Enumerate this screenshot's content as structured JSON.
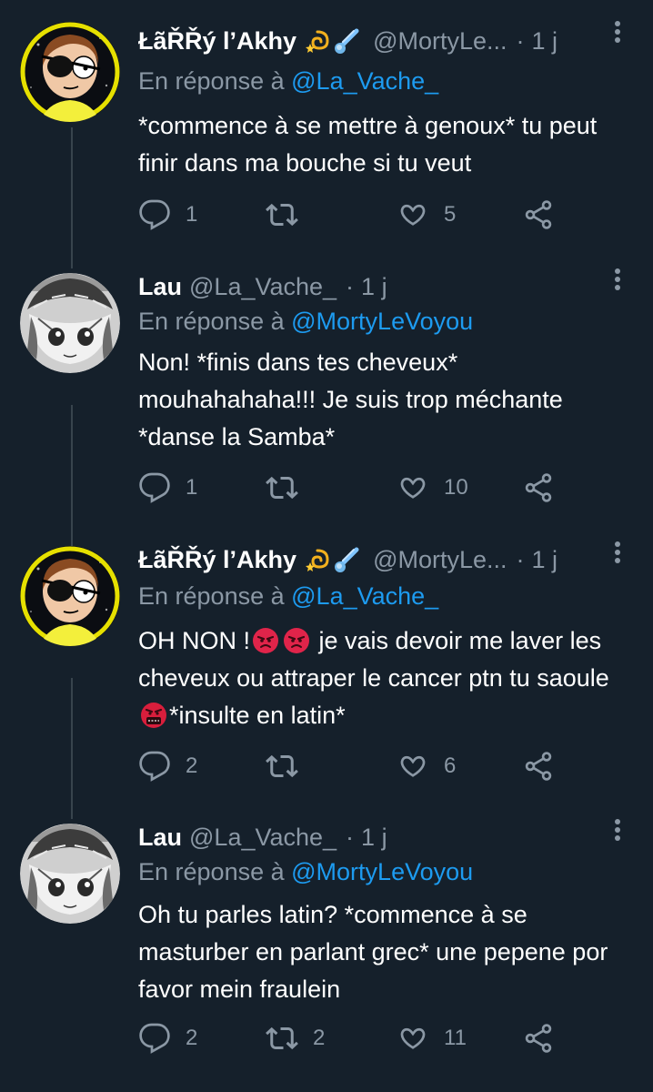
{
  "tweets": [
    {
      "name": "ŁãŘŘý l’Akhy",
      "handle": "@MortyLe...",
      "dot": "·",
      "time": "1 j",
      "reply_prefix": "En réponse à",
      "reply_mention": "@La_Vache_",
      "text": "*commence à se mettre à genoux* tu peut finir dans ma bouche si tu veut",
      "replies": "1",
      "retweets": "",
      "likes": "5"
    },
    {
      "name": "Lau",
      "handle": "@La_Vache_",
      "dot": "·",
      "time": "1 j",
      "reply_prefix": "En réponse à",
      "reply_mention": "@MortyLeVoyou",
      "text": "Non! *finis dans tes cheveux* mouhahahaha!!! Je suis trop méchante *danse la Samba*",
      "replies": "1",
      "retweets": "",
      "likes": "10"
    },
    {
      "name": "ŁãŘŘý l’Akhy",
      "handle": "@MortyLe...",
      "dot": "·",
      "time": "1 j",
      "reply_prefix": "En réponse à",
      "reply_mention": "@La_Vache_",
      "text_part1": "OH NON !",
      "text_part2": " je vais devoir me laver les cheveux ou attraper le cancer ptn tu saoule ",
      "text_part3": "*insulte en latin*",
      "replies": "2",
      "retweets": "",
      "likes": "6"
    },
    {
      "name": "Lau",
      "handle": "@La_Vache_",
      "dot": "·",
      "time": "1 j",
      "reply_prefix": "En réponse à",
      "reply_mention": "@MortyLeVoyou",
      "text": "Oh tu parles latin? *commence à se masturber en parlant grec* une pepene por favor mein fraulein",
      "replies": "2",
      "retweets": "2",
      "likes": "11"
    }
  ],
  "colors": {
    "background": "#15202b",
    "secondary_text": "#8b98a5",
    "link": "#1d9bf0",
    "thread_line": "#38444d"
  },
  "icons": [
    "reply-icon",
    "retweet-icon",
    "like-icon",
    "share-icon",
    "more-icon",
    "dizzy-emoji",
    "comet-emoji",
    "angry-face-emoji",
    "cursing-face-emoji"
  ]
}
